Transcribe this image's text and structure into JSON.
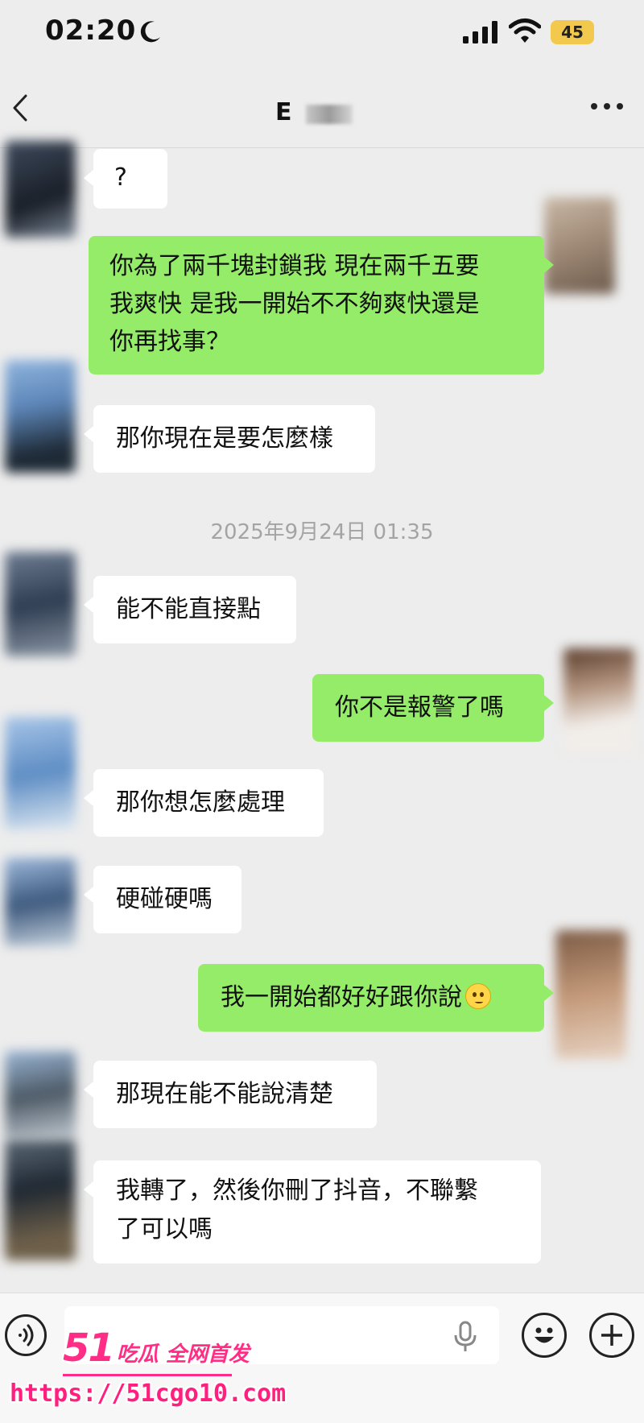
{
  "status_bar": {
    "time": "02:20",
    "battery": "45",
    "icons": [
      "moon-icon",
      "signal-icon",
      "wifi-icon",
      "battery-icon"
    ]
  },
  "header": {
    "contact_name": "E",
    "icons": [
      "back-icon",
      "more-icon"
    ]
  },
  "messages": [
    {
      "side": "in",
      "text": "?"
    },
    {
      "side": "out",
      "lines": [
        "你為了兩千塊封鎖我 現在兩千五要",
        "我爽快 是我一開始不不夠爽快還是",
        "你再找事？"
      ]
    },
    {
      "side": "in",
      "text": "那你現在是要怎麼樣"
    },
    {
      "side": "in",
      "text": "能不能直接點"
    },
    {
      "side": "out",
      "text": "你不是報警了嗎"
    },
    {
      "side": "in",
      "text": "那你想怎麼處理"
    },
    {
      "side": "in",
      "text": "硬碰硬嗎"
    },
    {
      "side": "out",
      "text": "我一開始都好好跟你說",
      "emoji": "flushed-face-emoji"
    },
    {
      "side": "in",
      "text": "那現在能不能說清楚"
    },
    {
      "side": "in",
      "lines": [
        "我轉了，然後你刪了抖音，不聯繫",
        "了可以嗎"
      ]
    }
  ],
  "timestamp": "2025年9月24日 01:35",
  "input_bar": {
    "placeholder": "",
    "icons": [
      "voice-icon",
      "mic-icon",
      "emoji-icon",
      "plus-icon"
    ]
  },
  "watermark": {
    "brand": "51",
    "slogan": "吃瓜 全网首发",
    "url": "https://51cgo10.com"
  },
  "colors": {
    "background": "#ededed",
    "outgoing_bubble": "#95ec69",
    "incoming_bubble": "#ffffff",
    "watermark": "#ff2d86"
  }
}
